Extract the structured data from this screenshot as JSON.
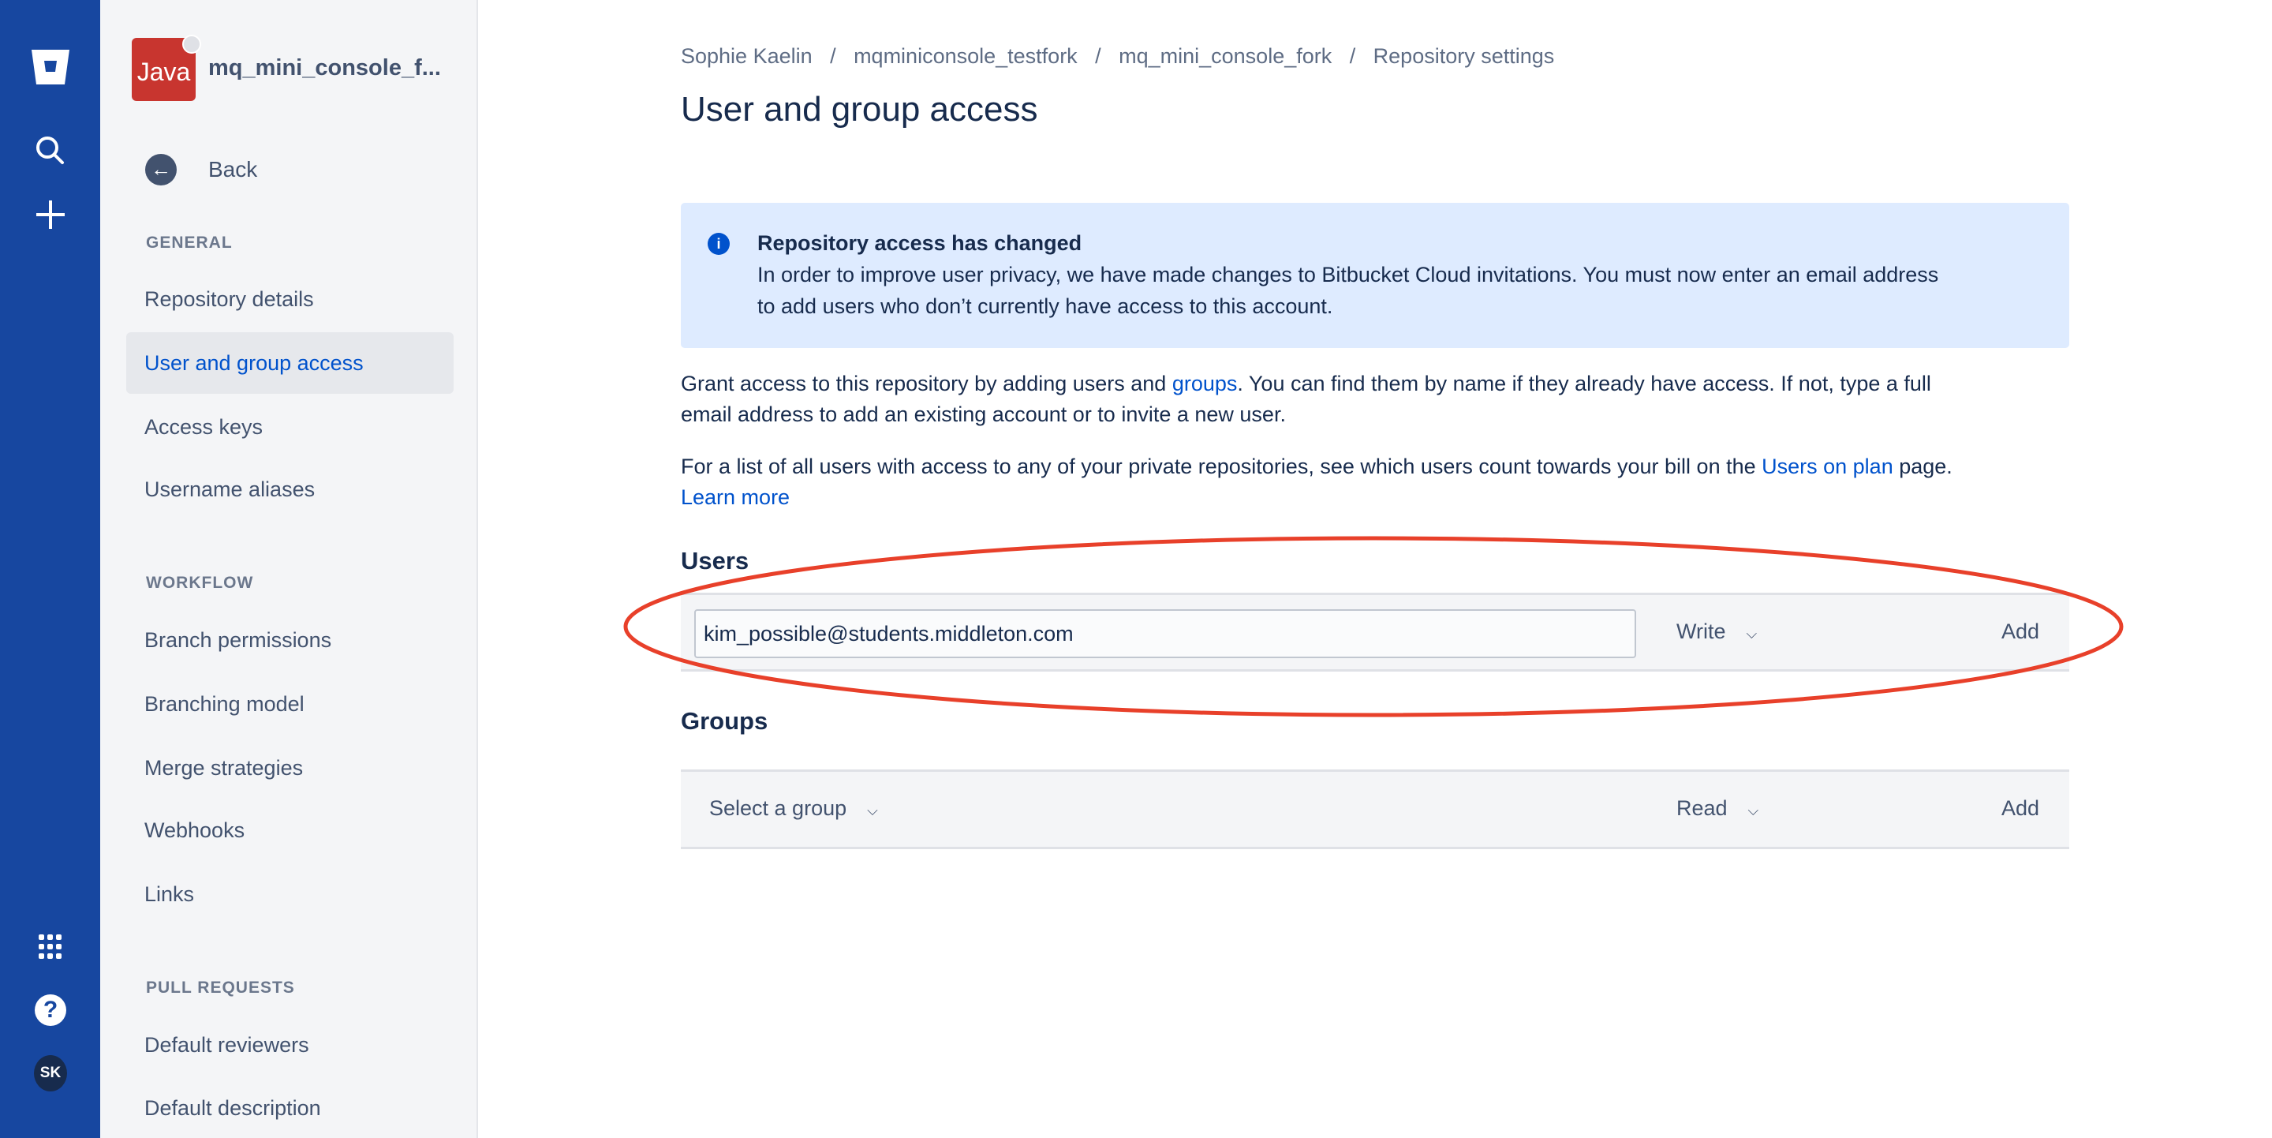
{
  "global_nav": {
    "avatar_initials": "SK",
    "brand_color": "#1747a0"
  },
  "repo": {
    "name": "mq_mini_console_f...",
    "avatar_text": "Java"
  },
  "sidebar": {
    "back": "Back",
    "sections": [
      {
        "label": "GENERAL",
        "items": [
          "Repository details",
          "User and group access",
          "Access keys",
          "Username aliases"
        ]
      },
      {
        "label": "WORKFLOW",
        "items": [
          "Branch permissions",
          "Branching model",
          "Merge strategies",
          "Webhooks",
          "Links"
        ]
      },
      {
        "label": "PULL REQUESTS",
        "items": [
          "Default reviewers",
          "Default description"
        ]
      }
    ],
    "selected": "User and group access"
  },
  "breadcrumb": [
    "Sophie Kaelin",
    "mqminiconsole_testfork",
    "mq_mini_console_fork",
    "Repository settings"
  ],
  "breadcrumb_sep": "/",
  "title": "User and group access",
  "notice": {
    "heading": "Repository access has changed",
    "line1": "In order to improve user privacy, we have made changes to Bitbucket Cloud invitations. You must now enter an email address",
    "line2": "to add users who don’t currently have access to this account."
  },
  "para1": {
    "a": "Grant access to this repository by adding users and ",
    "link": "groups",
    "b": ". You can find them by name if they already have access. If not, type a full",
    "c": "email address to add an existing account or to invite a new user."
  },
  "para2": {
    "a": "For a list of all users with access to any of your private repositories, see which users count towards your bill on the ",
    "link": "Users on plan",
    "b": " page.",
    "learn": "Learn more"
  },
  "users": {
    "heading": "Users",
    "input_value": "kim_possible@students.middleton.com",
    "permission": "Write",
    "add": "Add"
  },
  "groups": {
    "heading": "Groups",
    "select": "Select a group",
    "permission": "Read",
    "add": "Add"
  }
}
